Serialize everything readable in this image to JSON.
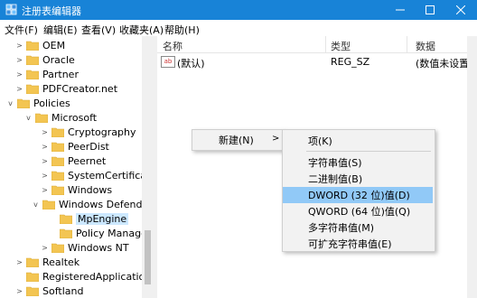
{
  "window": {
    "title": "注册表编辑器"
  },
  "menubar": [
    "文件(F)",
    "编辑(E)",
    "查看(V)",
    "收藏夹(A)",
    "帮助(H)"
  ],
  "tree": [
    {
      "label": "OEM",
      "arrow": ">"
    },
    {
      "label": "Oracle",
      "arrow": ">"
    },
    {
      "label": "Partner",
      "arrow": ">"
    },
    {
      "label": "PDFCreator.net",
      "arrow": ">"
    },
    {
      "label": "Policies",
      "arrow": "v"
    },
    {
      "label": "Microsoft",
      "arrow": "v"
    },
    {
      "label": "Cryptography",
      "arrow": ">"
    },
    {
      "label": "PeerDist",
      "arrow": ">"
    },
    {
      "label": "Peernet",
      "arrow": ">"
    },
    {
      "label": "SystemCertificates",
      "arrow": ">"
    },
    {
      "label": "Windows",
      "arrow": ">"
    },
    {
      "label": "Windows Defender",
      "arrow": "v"
    },
    {
      "label": "MpEngine",
      "arrow": "",
      "selected": true
    },
    {
      "label": "Policy Manager",
      "arrow": ""
    },
    {
      "label": "Windows NT",
      "arrow": ">"
    },
    {
      "label": "Realtek",
      "arrow": ">"
    },
    {
      "label": "RegisteredApplications",
      "arrow": ""
    },
    {
      "label": "Softland",
      "arrow": ">"
    }
  ],
  "list": {
    "columns": [
      "名称",
      "类型",
      "数据"
    ],
    "rows": [
      {
        "icon": "ab",
        "name": "(默认)",
        "type": "REG_SZ",
        "data": "(数值未设置)"
      }
    ]
  },
  "context_menu": {
    "new_label": "新建(N)",
    "arrow": ">"
  },
  "submenu": {
    "items": [
      "项(K)",
      "字符串值(S)",
      "二进制值(B)",
      "DWORD (32 位)值(D)",
      "QWORD (64 位)值(Q)",
      "多字符串值(M)",
      "可扩充字符串值(E)"
    ],
    "highlighted": 3
  },
  "colors": {
    "titlebar": "#1883d7",
    "selection": "#cce8ff",
    "menu_highlight": "#91c9f7",
    "folder": "#f3c552"
  }
}
